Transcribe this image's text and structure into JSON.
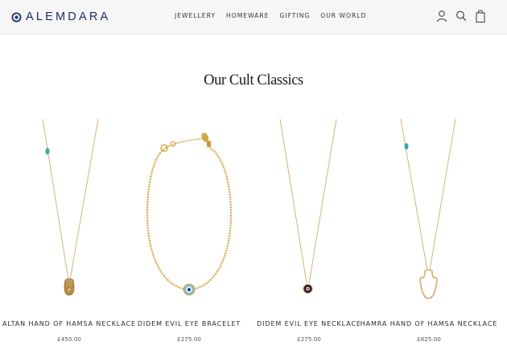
{
  "brand": {
    "name": "ALEMDARA",
    "logo_icon": "evil-eye-icon",
    "color": "#1f2a5c"
  },
  "nav": {
    "items": [
      {
        "label": "JEWELLERY"
      },
      {
        "label": "HOMEWARE"
      },
      {
        "label": "GIFTING"
      },
      {
        "label": "OUR WORLD"
      }
    ]
  },
  "header_icons": [
    "user-icon",
    "search-icon",
    "bag-icon"
  ],
  "section": {
    "title": "Our Cult Classics"
  },
  "products": [
    {
      "name": "ALTAN HAND OF HAMSA NECKLACE",
      "price": "£450.00",
      "image": "hamsa-necklace-gold"
    },
    {
      "name": "DIDEM EVIL EYE BRACELET",
      "price": "£275.00",
      "image": "evil-eye-bracelet"
    },
    {
      "name": "DIDEM EVIL EYE NECKLACE",
      "price": "£275.00",
      "image": "evil-eye-necklace"
    },
    {
      "name": "HAMRA HAND OF HAMSA NECKLACE",
      "price": "£625.00",
      "image": "hamsa-necklace-outline"
    }
  ],
  "colors": {
    "gold": "#c9a45c",
    "turquoise": "#3aa6a0",
    "eye_dark": "#2b1638",
    "header_bg": "#f6f6f7"
  }
}
